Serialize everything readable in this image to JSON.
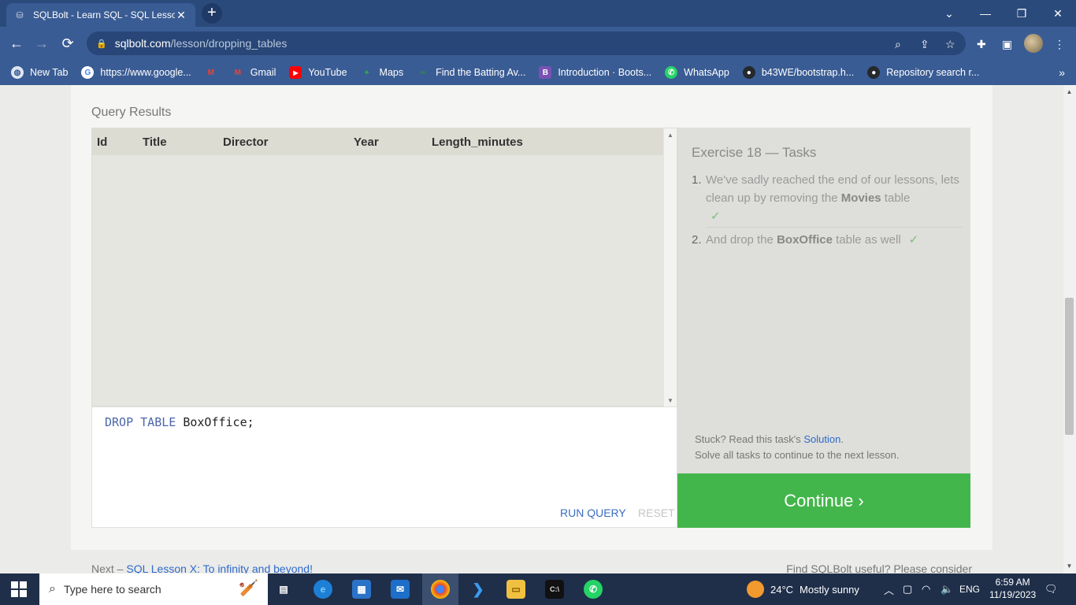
{
  "browser": {
    "tab_title": "SQLBolt - Learn SQL - SQL Lesso",
    "url_host": "sqlbolt.com",
    "url_path": "/lesson/dropping_tables",
    "bookmarks": [
      {
        "label": "New Tab",
        "icon": "globe-icon",
        "color": "#ffffff"
      },
      {
        "label": "https://www.google...",
        "icon": "google-icon",
        "color": "#ffffff"
      },
      {
        "label": "",
        "icon": "gmail-icon",
        "color": "#ea4335"
      },
      {
        "label": "Gmail",
        "icon": "gmail-icon",
        "color": "#ea4335"
      },
      {
        "label": "YouTube",
        "icon": "youtube-icon",
        "color": "#ff0000"
      },
      {
        "label": "Maps",
        "icon": "maps-icon",
        "color": "#34a853"
      },
      {
        "label": "Find the Batting Av...",
        "icon": "gfg-icon",
        "color": "#2f8d46"
      },
      {
        "label": "Introduction · Boots...",
        "icon": "bootstrap-icon",
        "color": "#7952b3"
      },
      {
        "label": "WhatsApp",
        "icon": "whatsapp-icon",
        "color": "#25d366"
      },
      {
        "label": "b43WE/bootstrap.h...",
        "icon": "github-icon",
        "color": "#24292e"
      },
      {
        "label": "Repository search r...",
        "icon": "github-icon",
        "color": "#24292e"
      }
    ]
  },
  "page": {
    "query_results_title": "Query Results",
    "columns": [
      "Id",
      "Title",
      "Director",
      "Year",
      "Length_minutes"
    ],
    "editor": {
      "keyword": "DROP TABLE",
      "rest": " BoxOffice;"
    },
    "run_label": "RUN QUERY",
    "reset_label": "RESET",
    "exercise_title": "Exercise 18 — Tasks",
    "tasks": [
      {
        "num": "1.",
        "pre": "We've sadly reached the end of our lessons, lets clean up by removing the ",
        "bold": "Movies",
        "post": " table",
        "check": "✓"
      },
      {
        "num": "2.",
        "pre": "And drop the ",
        "bold": "BoxOffice",
        "post": " table as well",
        "check": "✓"
      }
    ],
    "stuck_pre": "Stuck? Read this task's ",
    "solution_link": "Solution",
    "stuck_post": ".",
    "solve_all": "Solve all tasks to continue to the next lesson.",
    "continue_label": "Continue ›",
    "next_pre": "Next – ",
    "next_link": "SQL Lesson X: To infinity and beyond!",
    "useful_text": "Find SQLBolt useful? Please consider"
  },
  "taskbar": {
    "search_placeholder": "Type here to search",
    "weather_temp": "24°C",
    "weather_text": "Mostly sunny",
    "lang": "ENG",
    "time": "6:59 AM",
    "date": "11/19/2023"
  }
}
